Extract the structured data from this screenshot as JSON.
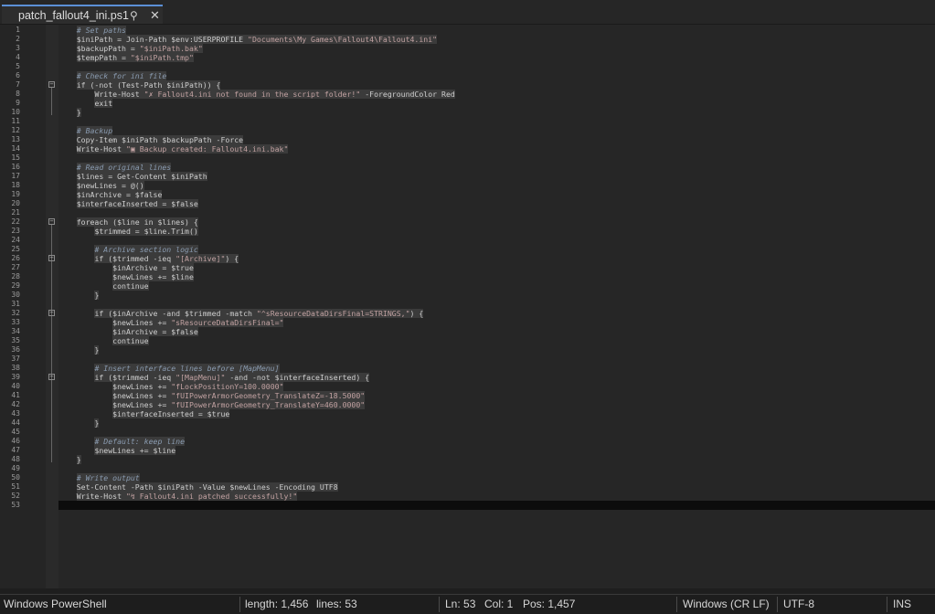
{
  "tab": {
    "title": "patch_fallout4_ini.ps1",
    "pin_icon": "pin-icon",
    "close_icon": "close-icon"
  },
  "editor": {
    "lines": [
      "    # Set paths",
      "    $iniPath = Join-Path $env:USERPROFILE \"Documents\\My Games\\Fallout4\\Fallout4.ini\"",
      "    $backupPath = \"$iniPath.bak\"",
      "    $tempPath = \"$iniPath.tmp\"",
      "",
      "    # Check for ini file",
      "    if (-not (Test-Path $iniPath)) {",
      "        Write-Host \"✗ Fallout4.ini not found in the script folder!\" -ForegroundColor Red",
      "        exit",
      "    }",
      "",
      "    # Backup",
      "    Copy-Item $iniPath $backupPath -Force",
      "    Write-Host \"▣ Backup created: Fallout4.ini.bak\"",
      "",
      "    # Read original lines",
      "    $lines = Get-Content $iniPath",
      "    $newLines = @()",
      "    $inArchive = $false",
      "    $interfaceInserted = $false",
      "",
      "    foreach ($line in $lines) {",
      "        $trimmed = $line.Trim()",
      "",
      "        # Archive section logic",
      "        if ($trimmed -ieq \"[Archive]\") {",
      "            $inArchive = $true",
      "            $newLines += $line",
      "            continue",
      "        }",
      "",
      "        if ($inArchive -and $trimmed -match \"^sResourceDataDirsFinal=STRINGS,\") {",
      "            $newLines += \"sResourceDataDirsFinal=\"",
      "            $inArchive = $false",
      "            continue",
      "        }",
      "",
      "        # Insert interface lines before [MapMenu]",
      "        if ($trimmed -ieq \"[MapMenu]\" -and -not $interfaceInserted) {",
      "            $newLines += \"fLockPositionY=100.0000\"",
      "            $newLines += \"fUIPowerArmorGeometry_TranslateZ=-18.5000\"",
      "            $newLines += \"fUIPowerArmorGeometry_TranslateY=460.0000\"",
      "            $interfaceInserted = $true",
      "        }",
      "",
      "        # Default: keep line",
      "        $newLines += $line",
      "    }",
      "",
      "    # Write output",
      "    Set-Content -Path $iniPath -Value $newLines -Encoding UTF8",
      "    Write-Host \"↯ Fallout4.ini patched successfully!\"",
      ""
    ],
    "fold_lines": [
      7,
      22,
      26,
      32,
      39
    ]
  },
  "status": {
    "language": "Windows PowerShell",
    "length": "length: 1,456",
    "lines": "lines: 53",
    "ln": "Ln: 53",
    "col": "Col: 1",
    "pos": "Pos: 1,457",
    "eol": "Windows (CR LF)",
    "encoding": "UTF-8",
    "mode": "INS"
  },
  "colors": {
    "background": "#1e1e1e",
    "tab_accent": "#5b8fd6",
    "comment": "#8a9bb0",
    "string": "#c2a2a2"
  }
}
